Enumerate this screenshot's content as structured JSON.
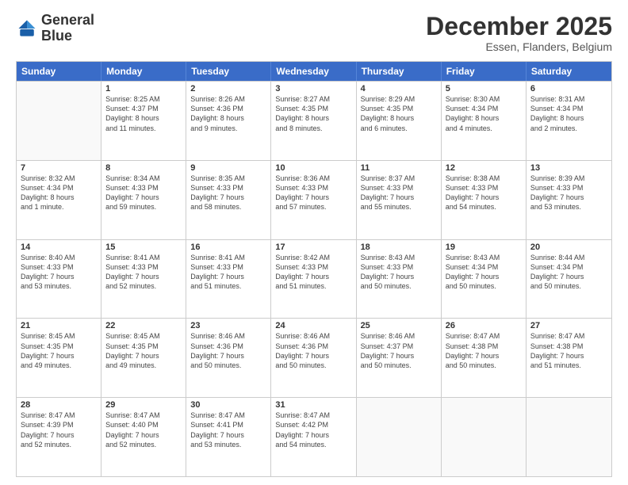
{
  "logo": {
    "line1": "General",
    "line2": "Blue"
  },
  "header": {
    "month": "December 2025",
    "location": "Essen, Flanders, Belgium"
  },
  "weekdays": [
    "Sunday",
    "Monday",
    "Tuesday",
    "Wednesday",
    "Thursday",
    "Friday",
    "Saturday"
  ],
  "rows": [
    [
      {
        "day": "",
        "sunrise": "",
        "sunset": "",
        "daylight": ""
      },
      {
        "day": "1",
        "sunrise": "Sunrise: 8:25 AM",
        "sunset": "Sunset: 4:37 PM",
        "daylight": "Daylight: 8 hours and 11 minutes."
      },
      {
        "day": "2",
        "sunrise": "Sunrise: 8:26 AM",
        "sunset": "Sunset: 4:36 PM",
        "daylight": "Daylight: 8 hours and 9 minutes."
      },
      {
        "day": "3",
        "sunrise": "Sunrise: 8:27 AM",
        "sunset": "Sunset: 4:35 PM",
        "daylight": "Daylight: 8 hours and 8 minutes."
      },
      {
        "day": "4",
        "sunrise": "Sunrise: 8:29 AM",
        "sunset": "Sunset: 4:35 PM",
        "daylight": "Daylight: 8 hours and 6 minutes."
      },
      {
        "day": "5",
        "sunrise": "Sunrise: 8:30 AM",
        "sunset": "Sunset: 4:34 PM",
        "daylight": "Daylight: 8 hours and 4 minutes."
      },
      {
        "day": "6",
        "sunrise": "Sunrise: 8:31 AM",
        "sunset": "Sunset: 4:34 PM",
        "daylight": "Daylight: 8 hours and 2 minutes."
      }
    ],
    [
      {
        "day": "7",
        "sunrise": "Sunrise: 8:32 AM",
        "sunset": "Sunset: 4:34 PM",
        "daylight": "Daylight: 8 hours and 1 minute."
      },
      {
        "day": "8",
        "sunrise": "Sunrise: 8:34 AM",
        "sunset": "Sunset: 4:33 PM",
        "daylight": "Daylight: 7 hours and 59 minutes."
      },
      {
        "day": "9",
        "sunrise": "Sunrise: 8:35 AM",
        "sunset": "Sunset: 4:33 PM",
        "daylight": "Daylight: 7 hours and 58 minutes."
      },
      {
        "day": "10",
        "sunrise": "Sunrise: 8:36 AM",
        "sunset": "Sunset: 4:33 PM",
        "daylight": "Daylight: 7 hours and 57 minutes."
      },
      {
        "day": "11",
        "sunrise": "Sunrise: 8:37 AM",
        "sunset": "Sunset: 4:33 PM",
        "daylight": "Daylight: 7 hours and 55 minutes."
      },
      {
        "day": "12",
        "sunrise": "Sunrise: 8:38 AM",
        "sunset": "Sunset: 4:33 PM",
        "daylight": "Daylight: 7 hours and 54 minutes."
      },
      {
        "day": "13",
        "sunrise": "Sunrise: 8:39 AM",
        "sunset": "Sunset: 4:33 PM",
        "daylight": "Daylight: 7 hours and 53 minutes."
      }
    ],
    [
      {
        "day": "14",
        "sunrise": "Sunrise: 8:40 AM",
        "sunset": "Sunset: 4:33 PM",
        "daylight": "Daylight: 7 hours and 53 minutes."
      },
      {
        "day": "15",
        "sunrise": "Sunrise: 8:41 AM",
        "sunset": "Sunset: 4:33 PM",
        "daylight": "Daylight: 7 hours and 52 minutes."
      },
      {
        "day": "16",
        "sunrise": "Sunrise: 8:41 AM",
        "sunset": "Sunset: 4:33 PM",
        "daylight": "Daylight: 7 hours and 51 minutes."
      },
      {
        "day": "17",
        "sunrise": "Sunrise: 8:42 AM",
        "sunset": "Sunset: 4:33 PM",
        "daylight": "Daylight: 7 hours and 51 minutes."
      },
      {
        "day": "18",
        "sunrise": "Sunrise: 8:43 AM",
        "sunset": "Sunset: 4:33 PM",
        "daylight": "Daylight: 7 hours and 50 minutes."
      },
      {
        "day": "19",
        "sunrise": "Sunrise: 8:43 AM",
        "sunset": "Sunset: 4:34 PM",
        "daylight": "Daylight: 7 hours and 50 minutes."
      },
      {
        "day": "20",
        "sunrise": "Sunrise: 8:44 AM",
        "sunset": "Sunset: 4:34 PM",
        "daylight": "Daylight: 7 hours and 50 minutes."
      }
    ],
    [
      {
        "day": "21",
        "sunrise": "Sunrise: 8:45 AM",
        "sunset": "Sunset: 4:35 PM",
        "daylight": "Daylight: 7 hours and 49 minutes."
      },
      {
        "day": "22",
        "sunrise": "Sunrise: 8:45 AM",
        "sunset": "Sunset: 4:35 PM",
        "daylight": "Daylight: 7 hours and 49 minutes."
      },
      {
        "day": "23",
        "sunrise": "Sunrise: 8:46 AM",
        "sunset": "Sunset: 4:36 PM",
        "daylight": "Daylight: 7 hours and 50 minutes."
      },
      {
        "day": "24",
        "sunrise": "Sunrise: 8:46 AM",
        "sunset": "Sunset: 4:36 PM",
        "daylight": "Daylight: 7 hours and 50 minutes."
      },
      {
        "day": "25",
        "sunrise": "Sunrise: 8:46 AM",
        "sunset": "Sunset: 4:37 PM",
        "daylight": "Daylight: 7 hours and 50 minutes."
      },
      {
        "day": "26",
        "sunrise": "Sunrise: 8:47 AM",
        "sunset": "Sunset: 4:38 PM",
        "daylight": "Daylight: 7 hours and 50 minutes."
      },
      {
        "day": "27",
        "sunrise": "Sunrise: 8:47 AM",
        "sunset": "Sunset: 4:38 PM",
        "daylight": "Daylight: 7 hours and 51 minutes."
      }
    ],
    [
      {
        "day": "28",
        "sunrise": "Sunrise: 8:47 AM",
        "sunset": "Sunset: 4:39 PM",
        "daylight": "Daylight: 7 hours and 52 minutes."
      },
      {
        "day": "29",
        "sunrise": "Sunrise: 8:47 AM",
        "sunset": "Sunset: 4:40 PM",
        "daylight": "Daylight: 7 hours and 52 minutes."
      },
      {
        "day": "30",
        "sunrise": "Sunrise: 8:47 AM",
        "sunset": "Sunset: 4:41 PM",
        "daylight": "Daylight: 7 hours and 53 minutes."
      },
      {
        "day": "31",
        "sunrise": "Sunrise: 8:47 AM",
        "sunset": "Sunset: 4:42 PM",
        "daylight": "Daylight: 7 hours and 54 minutes."
      },
      {
        "day": "",
        "sunrise": "",
        "sunset": "",
        "daylight": ""
      },
      {
        "day": "",
        "sunrise": "",
        "sunset": "",
        "daylight": ""
      },
      {
        "day": "",
        "sunrise": "",
        "sunset": "",
        "daylight": ""
      }
    ]
  ]
}
